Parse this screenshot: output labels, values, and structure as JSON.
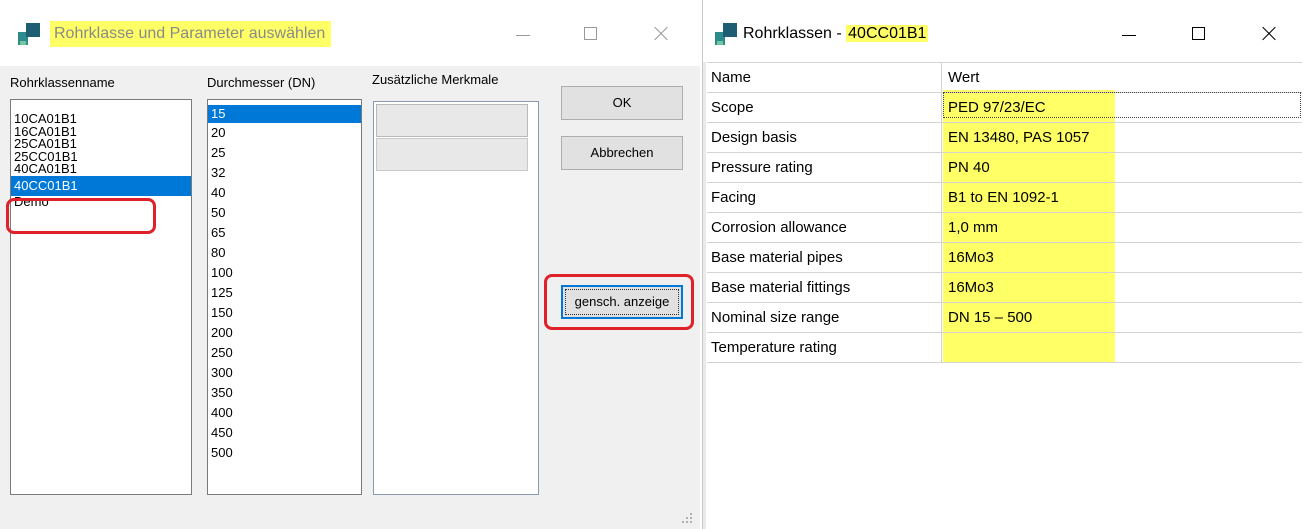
{
  "dialog1": {
    "title": "Rohrklasse und Parameter auswählen",
    "labels": {
      "class_name": "Rohrklassenname",
      "diameter": "Durchmesser (DN)",
      "features": "Zusätzliche Merkmale"
    },
    "classes": [
      "10CA01B1",
      "16CA01B1",
      "25CA01B1",
      "25CC01B1",
      "40CA01B1",
      "40CC01B1",
      "Demo"
    ],
    "selected_class": "40CC01B1",
    "diameters": [
      "15",
      "20",
      "25",
      "32",
      "40",
      "50",
      "65",
      "80",
      "100",
      "125",
      "150",
      "200",
      "250",
      "300",
      "350",
      "400",
      "450",
      "500"
    ],
    "selected_diameter": "15",
    "buttons": {
      "ok": "OK",
      "cancel": "Abbrechen",
      "show_props": "gensch. anzeige"
    }
  },
  "dialog2": {
    "title_prefix": "Rohrklassen - ",
    "title_class": "40CC01B1",
    "headers": {
      "name": "Name",
      "value": "Wert"
    },
    "rows": [
      {
        "name": "Scope",
        "value": "PED 97/23/EC"
      },
      {
        "name": "Design basis",
        "value": "EN 13480, PAS 1057"
      },
      {
        "name": "Pressure rating",
        "value": "PN 40"
      },
      {
        "name": "Facing",
        "value": "B1 to EN 1092-1"
      },
      {
        "name": "Corrosion allowance",
        "value": "1,0 mm"
      },
      {
        "name": "Base material pipes",
        "value": "16Mo3"
      },
      {
        "name": "Base material fittings",
        "value": "16Mo3"
      },
      {
        "name": "Nominal size range",
        "value": "DN 15 – 500"
      },
      {
        "name": "Temperature rating",
        "value": ""
      }
    ]
  },
  "colors": {
    "highlight_yellow": "#ffff66",
    "selection_blue": "#0078d7",
    "annotation_red": "#e0202a"
  }
}
